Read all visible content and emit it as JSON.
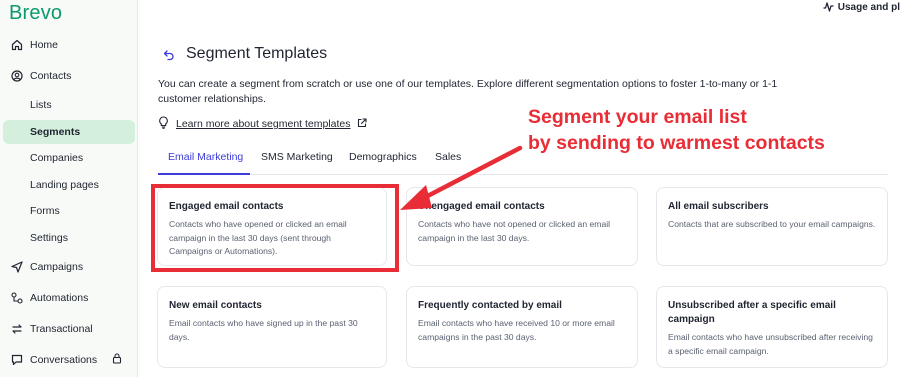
{
  "app": {
    "logo": "Brevo"
  },
  "topbar": {
    "usage_label": "Usage and pl",
    "usage_icon": "activity-icon"
  },
  "sidebar": {
    "items": [
      {
        "label": "Home",
        "icon": "home-icon"
      },
      {
        "label": "Contacts",
        "icon": "contact-icon"
      },
      {
        "label": "Lists"
      },
      {
        "label": "Segments",
        "active": true
      },
      {
        "label": "Companies"
      },
      {
        "label": "Landing pages"
      },
      {
        "label": "Forms"
      },
      {
        "label": "Settings"
      },
      {
        "label": "Campaigns",
        "icon": "send-icon"
      },
      {
        "label": "Automations",
        "icon": "automation-icon"
      },
      {
        "label": "Transactional",
        "icon": "transfer-icon"
      },
      {
        "label": "Conversations",
        "icon": "chat-icon",
        "locked": true
      }
    ]
  },
  "header": {
    "title": "Segment Templates",
    "description": "You can create a segment from scratch or use one of our templates. Explore different segmentation options to foster 1-to-many or 1-1 customer relationships.",
    "learn_link": "Learn more about segment templates"
  },
  "tabs": [
    {
      "label": "Email Marketing",
      "active": true
    },
    {
      "label": "SMS Marketing"
    },
    {
      "label": "Demographics"
    },
    {
      "label": "Sales"
    }
  ],
  "cards": [
    {
      "title": "Engaged email contacts",
      "desc": "Contacts who have opened or clicked an email campaign in the last 30 days (sent through Campaigns or Automations).",
      "highlighted": true
    },
    {
      "title": "Unengaged email contacts",
      "desc": "Contacts who have not opened or clicked an email campaign in the last 30 days."
    },
    {
      "title": "All email subscribers",
      "desc": "Contacts that are subscribed to your email campaigns."
    },
    {
      "title": "New email contacts",
      "desc": "Email contacts who have signed up in the past 30 days."
    },
    {
      "title": "Frequently contacted by email",
      "desc": "Email contacts who have received 10 or more email campaigns in the past 30 days."
    },
    {
      "title": "Unsubscribed after a specific email campaign",
      "desc": "Email contacts who have unsubscribed after receiving a specific email campaign."
    }
  ],
  "annotation": {
    "line1": "Segment your email list",
    "line2": "by sending to warmest contacts",
    "color": "#e92d36"
  },
  "colors": {
    "brand": "#0b996e",
    "accent": "#3d3bd9",
    "active_bg": "#d4f0dd"
  }
}
